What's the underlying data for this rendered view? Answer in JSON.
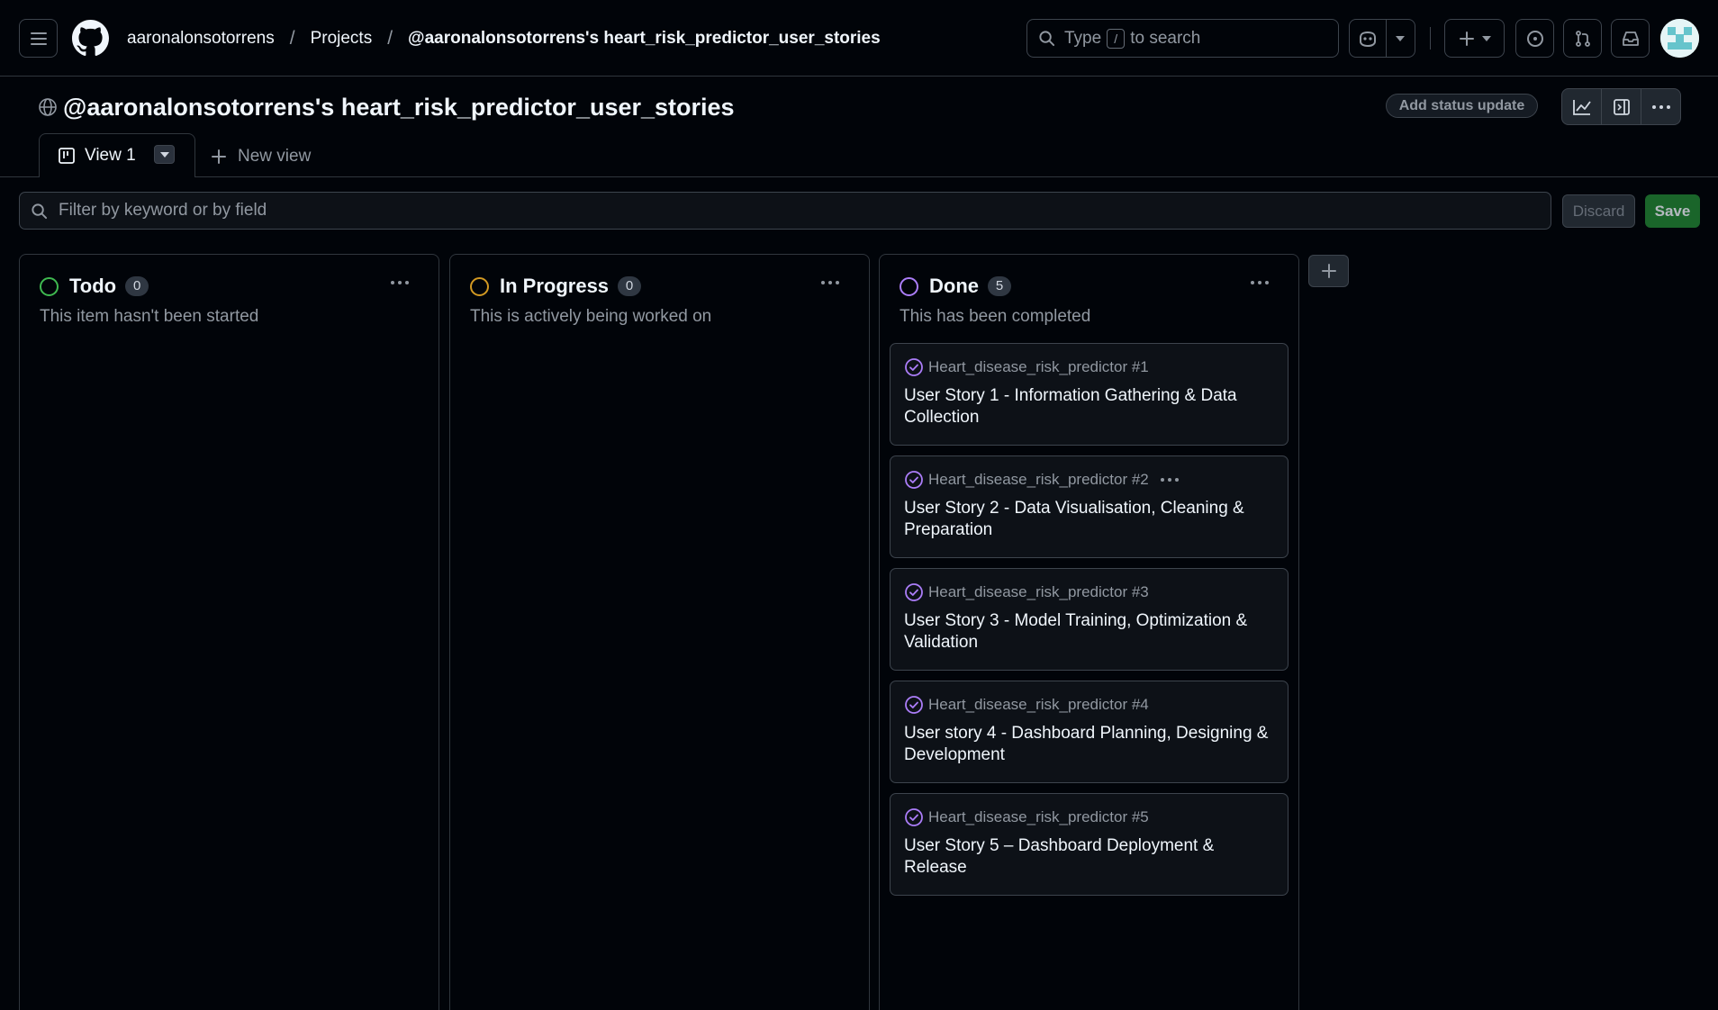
{
  "header": {
    "breadcrumbs": [
      "aaronalonsotorrens",
      "Projects",
      "@aaronalonsotorrens's heart_risk_predictor_user_stories"
    ],
    "search": {
      "prefix": "Type",
      "key": "/",
      "suffix": "to search"
    }
  },
  "project": {
    "title": "@aaronalonsotorrens's heart_risk_predictor_user_stories",
    "status_button": "Add status update"
  },
  "tabs": {
    "active": "View 1",
    "new_view": "New view"
  },
  "filter": {
    "placeholder": "Filter by keyword or by field",
    "discard": "Discard",
    "save": "Save"
  },
  "columns": [
    {
      "name": "Todo",
      "count": "0",
      "description": "This item hasn't been started",
      "color": "#3fb950",
      "cards": []
    },
    {
      "name": "In Progress",
      "count": "0",
      "description": "This is actively being worked on",
      "color": "#d29922",
      "cards": []
    },
    {
      "name": "Done",
      "count": "5",
      "description": "This has been completed",
      "color": "#ab7df8",
      "cards": [
        {
          "ref": "Heart_disease_risk_predictor #1",
          "title": "User Story 1 - Information Gathering & Data Collection"
        },
        {
          "ref": "Heart_disease_risk_predictor #2",
          "title": "User Story 2 - Data Visualisation, Cleaning & Preparation"
        },
        {
          "ref": "Heart_disease_risk_predictor #3",
          "title": "User Story 3 - Model Training, Optimization & Validation"
        },
        {
          "ref": "Heart_disease_risk_predictor #4",
          "title": "User story 4 - Dashboard Planning, Designing & Development"
        },
        {
          "ref": "Heart_disease_risk_predictor #5",
          "title": "User Story 5 – Dashboard Deployment & Release"
        }
      ]
    }
  ]
}
